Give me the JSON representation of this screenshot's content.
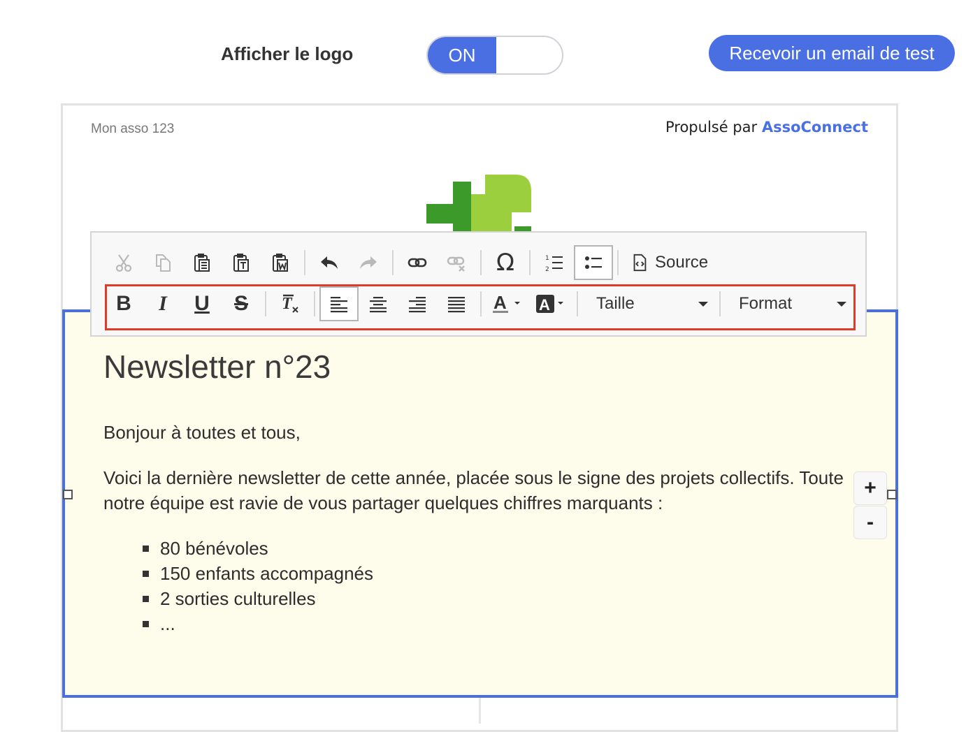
{
  "header": {
    "logo_label": "Afficher le logo",
    "toggle_state": "ON",
    "test_email_button": "Recevoir un email de test"
  },
  "email": {
    "org_name": "Mon asso 123",
    "powered_prefix": "Propulsé par",
    "powered_brand": "AssoConnect"
  },
  "toolbar": {
    "source_label": "Source",
    "size_label": "Taille",
    "format_label": "Format",
    "bold": "B",
    "italic": "I",
    "underline": "U",
    "strike": "S"
  },
  "content": {
    "headline": "Newsletter n°23",
    "greeting": "Bonjour à toutes et tous,",
    "intro": "Voici la dernière newsletter de cette année, placée sous le signe des projets collectifs. Toute notre équipe est ravie de vous partager quelques chiffres marquants :",
    "items": [
      "80 bénévoles",
      "150 enfants accompagnés",
      "2 sorties culturelles",
      "..."
    ]
  },
  "zoom": {
    "plus": "+",
    "minus": "-"
  },
  "colors": {
    "accent": "#4a6fe3",
    "highlight_box": "#e03a2d",
    "content_bg": "#fefceb"
  }
}
